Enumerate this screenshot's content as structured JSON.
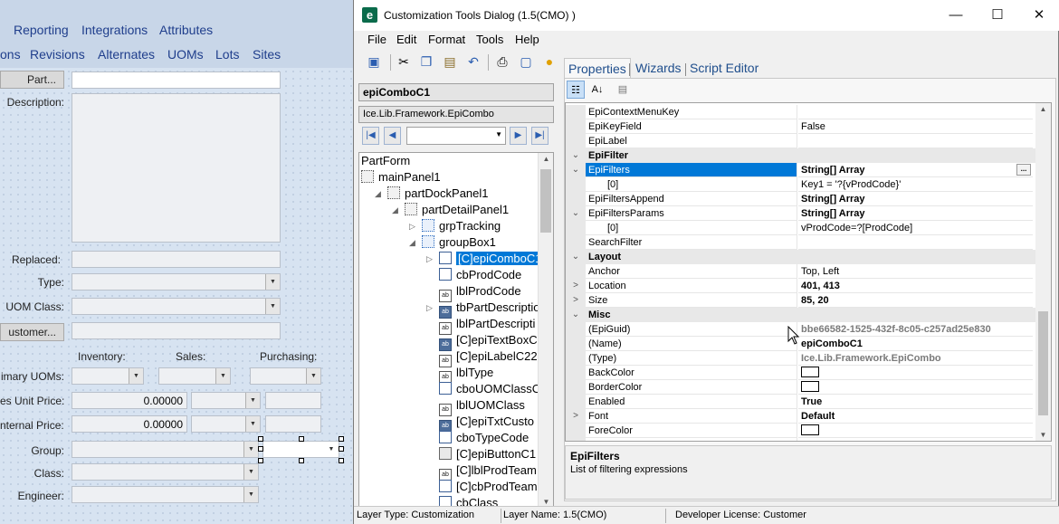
{
  "background": {
    "top_tabs": [
      "Reporting",
      "Integrations",
      "Attributes"
    ],
    "sub_tabs": [
      "ons",
      "Revisions",
      "Alternates",
      "UOMs",
      "Lots",
      "Sites"
    ],
    "part_button": "Part...",
    "customer_button": "ustomer...",
    "labels": {
      "description": "Description:",
      "replaced": "Replaced:",
      "type": "Type:",
      "uom_class": "UOM Class:",
      "inventory": "Inventory:",
      "sales": "Sales:",
      "purchasing": "Purchasing:",
      "primary_uoms": "imary UOMs:",
      "unit_price": "es Unit Price:",
      "internal_price": "nternal Price:",
      "group": "Group:",
      "class": "Class:",
      "engineer": "Engineer:"
    },
    "unit_price_value": "0.00000",
    "internal_price_value": "0.00000"
  },
  "dialog": {
    "app_icon_letter": "e",
    "title": "Customization Tools Dialog  (1.5(CMO) )",
    "window_controls": {
      "minimize": "—",
      "maximize": "☐",
      "close": "✕"
    },
    "menu": [
      "File",
      "Edit",
      "Format",
      "Tools",
      "Help"
    ],
    "toolbar_icons": [
      "save-icon",
      "cut-icon",
      "copy-icon",
      "paste-icon",
      "undo-icon",
      "print-icon",
      "print-preview-icon",
      "help-icon"
    ],
    "selected_control_name": "epiComboC1",
    "selected_control_type": "Ice.Lib.Framework.EpiCombo",
    "tree": [
      {
        "label": "PartForm",
        "depth": 0,
        "icon": "none"
      },
      {
        "label": "mainPanel1",
        "depth": 0,
        "icon": "dot"
      },
      {
        "label": "partDockPanel1",
        "depth": 1,
        "icon": "dot",
        "expander": "◢"
      },
      {
        "label": "partDetailPanel1",
        "depth": 2,
        "icon": "dot",
        "expander": "◢"
      },
      {
        "label": "grpTracking",
        "depth": 3,
        "icon": "grp",
        "expander": "▷"
      },
      {
        "label": "groupBox1",
        "depth": 3,
        "icon": "grp",
        "expander": "◢"
      },
      {
        "label": "[C]epiComboC1",
        "depth": 4,
        "icon": "cbo",
        "expander": "▷",
        "selected": true
      },
      {
        "label": "cbProdCode",
        "depth": 4,
        "icon": "cbo"
      },
      {
        "label": "lblProdCode",
        "depth": 4,
        "icon": "lbl"
      },
      {
        "label": "tbPartDescriptio",
        "depth": 4,
        "icon": "txt",
        "expander": "▷"
      },
      {
        "label": "lblPartDescripti",
        "depth": 4,
        "icon": "lbl"
      },
      {
        "label": "[C]epiTextBoxC",
        "depth": 4,
        "icon": "txt"
      },
      {
        "label": "[C]epiLabelC22",
        "depth": 4,
        "icon": "lbl"
      },
      {
        "label": "lblType",
        "depth": 4,
        "icon": "lbl"
      },
      {
        "label": "cboUOMClassC",
        "depth": 4,
        "icon": "cbo"
      },
      {
        "label": "lblUOMClass",
        "depth": 4,
        "icon": "lbl"
      },
      {
        "label": "[C]epiTxtCusto",
        "depth": 4,
        "icon": "txt"
      },
      {
        "label": "cboTypeCode",
        "depth": 4,
        "icon": "cbo"
      },
      {
        "label": "[C]epiButtonC1",
        "depth": 4,
        "icon": "btn"
      },
      {
        "label": "[C]lblProdTeam",
        "depth": 4,
        "icon": "lbl"
      },
      {
        "label": "[C]cbProdTeam",
        "depth": 4,
        "icon": "cbo"
      },
      {
        "label": "cbClass",
        "depth": 4,
        "icon": "cbo"
      }
    ],
    "tabs": [
      "Properties",
      "Wizards",
      "Script Editor"
    ],
    "properties": [
      {
        "name": "EpiContextMenuKey",
        "value": ""
      },
      {
        "name": "EpiKeyField",
        "value": "False"
      },
      {
        "name": "EpiLabel",
        "value": ""
      },
      {
        "category": "EpiFilter"
      },
      {
        "name": "EpiFilters",
        "value": "String[] Array",
        "bold": true,
        "selected": true,
        "expander": "⌄",
        "ellipsis": true
      },
      {
        "name": "[0]",
        "value": "Key1 = '?{vProdCode}'",
        "indent": true
      },
      {
        "name": "EpiFiltersAppend",
        "value": "String[] Array",
        "bold": true
      },
      {
        "name": "EpiFiltersParams",
        "value": "String[] Array",
        "bold": true,
        "expander": "⌄"
      },
      {
        "name": "[0]",
        "value": "vProdCode=?[ProdCode]",
        "indent": true
      },
      {
        "name": "SearchFilter",
        "value": ""
      },
      {
        "category": "Layout"
      },
      {
        "name": "Anchor",
        "value": "Top, Left"
      },
      {
        "name": "Location",
        "value": "401, 413",
        "bold": true,
        "expander": ">"
      },
      {
        "name": "Size",
        "value": "85, 20",
        "bold": true,
        "expander": ">"
      },
      {
        "category": "Misc"
      },
      {
        "name": "(EpiGuid)",
        "value": "bbe66582-1525-432f-8c05-c257ad25e830",
        "gray": true,
        "bold": true
      },
      {
        "name": "(Name)",
        "value": "epiComboC1",
        "bold": true
      },
      {
        "name": "(Type)",
        "value": "Ice.Lib.Framework.EpiCombo",
        "gray": true,
        "bold": true
      },
      {
        "name": "BackColor",
        "value": "",
        "swatch": true
      },
      {
        "name": "BorderColor",
        "value": "",
        "swatch": true
      },
      {
        "name": "Enabled",
        "value": "True",
        "bold": true
      },
      {
        "name": "Font",
        "value": "Default",
        "bold": true,
        "expander": ">"
      },
      {
        "name": "ForeColor",
        "value": "",
        "swatch": true
      },
      {
        "name": "StyleSetName",
        "value": ""
      }
    ],
    "description": {
      "title": "EpiFilters",
      "text": "List of filtering expressions"
    },
    "status": {
      "layer_type": "Layer Type:  Customization",
      "layer_name": "Layer Name:  1.5(CMO)",
      "license": "Developer License:  Customer"
    },
    "colors": {
      "accent": "#0078d7",
      "link": "#1f4e8c",
      "app_icon": "#0a6b4b"
    }
  }
}
